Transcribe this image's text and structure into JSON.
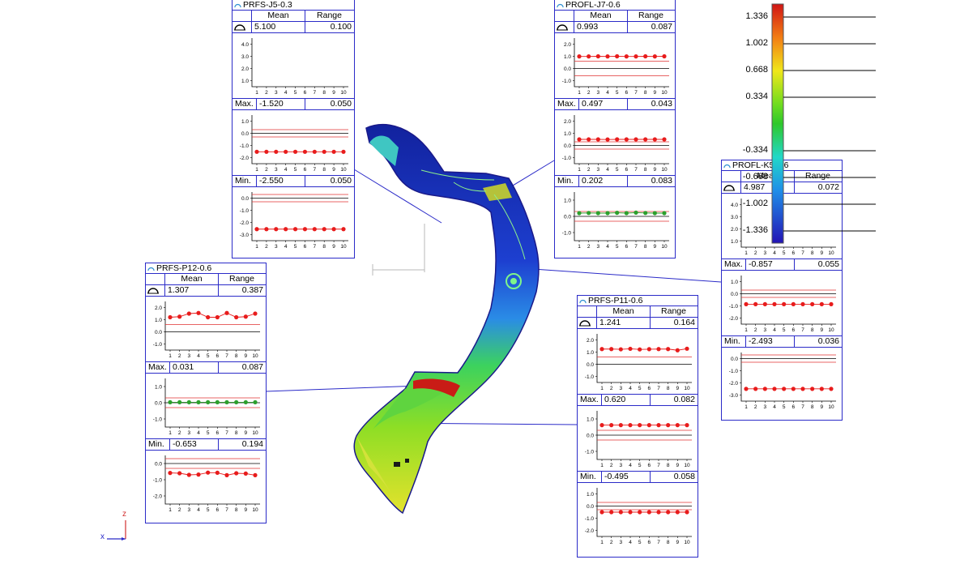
{
  "headers": {
    "mean": "Mean",
    "range": "Range",
    "max": "Max.",
    "min": "Min."
  },
  "colors": {
    "frame": "#2b2bc8",
    "nominal": "#000000",
    "tolerance": "#e03030",
    "point_out": "#e81c1c",
    "point_in": "#2da02d"
  },
  "color_scale": {
    "labels": [
      "1.336",
      "1.002",
      "0.668",
      "0.334",
      "-0.334",
      "-0.668",
      "-1.002",
      "-1.336"
    ]
  },
  "axes": {
    "x": "x",
    "z": "z"
  },
  "panels": [
    {
      "id": "p1",
      "title": "PRFS-J5-0.3",
      "mean": "5.100",
      "range": "0.100",
      "mean_plot": {
        "yticks": [
          "4.0",
          "3.0",
          "2.0",
          "1.0"
        ],
        "y": [],
        "nominal": null,
        "tol": []
      },
      "max": "-1.520",
      "max_range": "0.050",
      "max_plot": {
        "yticks": [
          "1.0",
          "0.0",
          "-1.0",
          "-2.0"
        ],
        "y": [
          -1.52,
          -1.52,
          -1.52,
          -1.52,
          -1.52,
          -1.52,
          -1.52,
          -1.52,
          -1.52,
          -1.52
        ],
        "nominal": 0.0,
        "tol": [
          0.3,
          -0.3
        ],
        "status": "out"
      },
      "min": "-2.550",
      "min_range": "0.050",
      "min_plot": {
        "yticks": [
          "0.0",
          "-1.0",
          "-2.0",
          "-3.0"
        ],
        "y": [
          -2.55,
          -2.55,
          -2.55,
          -2.55,
          -2.55,
          -2.55,
          -2.55,
          -2.55,
          -2.55,
          -2.55
        ],
        "nominal": 0.0,
        "tol": [
          0.3,
          -0.3
        ],
        "status": "out"
      }
    },
    {
      "id": "p2",
      "title": "PROFL-J7-0.6",
      "mean": "0.993",
      "range": "0.087",
      "mean_plot": {
        "yticks": [
          "2.0",
          "1.0",
          "0.0",
          "-1.0"
        ],
        "y": [
          0.99,
          0.99,
          1.0,
          0.99,
          1.0,
          0.99,
          0.99,
          1.0,
          0.99,
          1.0
        ],
        "nominal": 0.0,
        "tol": [
          0.6,
          -0.6
        ],
        "status": "out"
      },
      "max": "0.497",
      "max_range": "0.043",
      "max_plot": {
        "yticks": [
          "2.0",
          "1.0",
          "0.0",
          "-1.0"
        ],
        "y": [
          0.5,
          0.5,
          0.5,
          0.49,
          0.5,
          0.5,
          0.5,
          0.5,
          0.5,
          0.5
        ],
        "nominal": 0.0,
        "tol": [
          0.3,
          -0.3
        ],
        "status": "out"
      },
      "min": "0.202",
      "min_range": "0.083",
      "min_plot": {
        "yticks": [
          "1.0",
          "0.0",
          "-1.0"
        ],
        "y": [
          0.2,
          0.21,
          0.2,
          0.2,
          0.22,
          0.2,
          0.23,
          0.21,
          0.2,
          0.2
        ],
        "nominal": 0.0,
        "tol": [
          0.3,
          -0.3
        ],
        "status": "in"
      }
    },
    {
      "id": "p3",
      "title": "PROFL-K5-0.6",
      "mean": "4.987",
      "range": "0.072",
      "mean_plot": {
        "yticks": [
          "4.0",
          "3.0",
          "2.0",
          "1.0"
        ],
        "y": [],
        "nominal": null,
        "tol": []
      },
      "max": "-0.857",
      "max_range": "0.055",
      "max_plot": {
        "yticks": [
          "1.0",
          "0.0",
          "-1.0",
          "-2.0"
        ],
        "y": [
          -0.86,
          -0.86,
          -0.86,
          -0.86,
          -0.86,
          -0.86,
          -0.86,
          -0.86,
          -0.86,
          -0.86
        ],
        "nominal": 0.0,
        "tol": [
          0.3,
          -0.3
        ],
        "status": "out"
      },
      "min": "-2.493",
      "min_range": "0.036",
      "min_plot": {
        "yticks": [
          "0.0",
          "-1.0",
          "-2.0",
          "-3.0"
        ],
        "y": [
          -2.49,
          -2.49,
          -2.49,
          -2.49,
          -2.49,
          -2.49,
          -2.49,
          -2.49,
          -2.49,
          -2.49
        ],
        "nominal": 0.0,
        "tol": [
          0.3,
          -0.3
        ],
        "status": "out"
      }
    },
    {
      "id": "p4",
      "title": "PRFS-P12-0.6",
      "mean": "1.307",
      "range": "0.387",
      "mean_plot": {
        "yticks": [
          "2.0",
          "1.0",
          "0.0",
          "-1.0"
        ],
        "y": [
          1.2,
          1.25,
          1.5,
          1.55,
          1.2,
          1.2,
          1.55,
          1.2,
          1.25,
          1.5
        ],
        "nominal": 0.0,
        "tol": [
          0.6
        ],
        "status": "out"
      },
      "max": "0.031",
      "max_range": "0.087",
      "max_plot": {
        "yticks": [
          "1.0",
          "0.0",
          "-1.0"
        ],
        "y": [
          0.03,
          0.03,
          0.03,
          0.03,
          0.03,
          0.03,
          0.03,
          0.03,
          0.03,
          0.03
        ],
        "nominal": 0.0,
        "tol": [
          0.3,
          -0.3
        ],
        "status": "in"
      },
      "min": "-0.653",
      "min_range": "0.194",
      "min_plot": {
        "yticks": [
          "0.0",
          "-1.0",
          "-2.0"
        ],
        "y": [
          -0.58,
          -0.6,
          -0.7,
          -0.68,
          -0.56,
          -0.57,
          -0.72,
          -0.6,
          -0.62,
          -0.72
        ],
        "nominal": 0.0,
        "tol": [
          0.3,
          -0.3
        ],
        "status": "out"
      }
    },
    {
      "id": "p5",
      "title": "PRFS-P11-0.6",
      "mean": "1.241",
      "range": "0.164",
      "mean_plot": {
        "yticks": [
          "2.0",
          "1.0",
          "0.0",
          "-1.0"
        ],
        "y": [
          1.25,
          1.25,
          1.23,
          1.27,
          1.22,
          1.24,
          1.25,
          1.25,
          1.15,
          1.28
        ],
        "nominal": 0.0,
        "tol": [
          0.6
        ],
        "status": "out"
      },
      "max": "0.620",
      "max_range": "0.082",
      "max_plot": {
        "yticks": [
          "1.0",
          "0.0",
          "-1.0"
        ],
        "y": [
          0.62,
          0.62,
          0.62,
          0.62,
          0.62,
          0.62,
          0.62,
          0.62,
          0.62,
          0.62
        ],
        "nominal": 0.0,
        "tol": [
          0.3,
          -0.3
        ],
        "status": "out"
      },
      "min": "-0.495",
      "min_range": "0.058",
      "min_plot": {
        "yticks": [
          "1.0",
          "0.0",
          "-1.0",
          "-2.0"
        ],
        "y": [
          -0.5,
          -0.5,
          -0.5,
          -0.5,
          -0.5,
          -0.5,
          -0.5,
          -0.5,
          -0.5,
          -0.5
        ],
        "nominal": 0.0,
        "tol": [
          0.3,
          -0.3
        ],
        "status": "out"
      }
    }
  ]
}
